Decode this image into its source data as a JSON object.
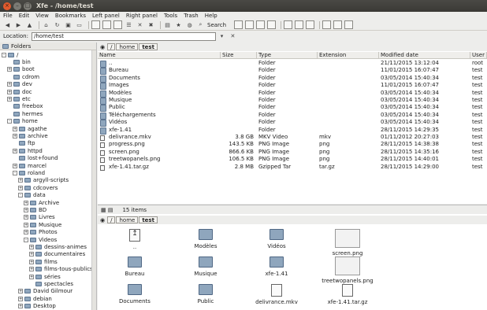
{
  "window": {
    "title": "Xfe - /home/test"
  },
  "menu": [
    "File",
    "Edit",
    "View",
    "Bookmarks",
    "Left panel",
    "Right panel",
    "Tools",
    "Trash",
    "Help"
  ],
  "toolbar": {
    "search_label": "Search"
  },
  "location": {
    "label": "Location:",
    "value": "/home/test"
  },
  "sidebar": {
    "header": "Folders",
    "tree": [
      {
        "label": "/",
        "depth": 0,
        "exp": "-"
      },
      {
        "label": "bin",
        "depth": 1,
        "exp": ""
      },
      {
        "label": "boot",
        "depth": 1,
        "exp": "+"
      },
      {
        "label": "cdrom",
        "depth": 1,
        "exp": ""
      },
      {
        "label": "dev",
        "depth": 1,
        "exp": "+"
      },
      {
        "label": "doc",
        "depth": 1,
        "exp": "+"
      },
      {
        "label": "etc",
        "depth": 1,
        "exp": "+"
      },
      {
        "label": "freebox",
        "depth": 1,
        "exp": ""
      },
      {
        "label": "hermes",
        "depth": 1,
        "exp": ""
      },
      {
        "label": "home",
        "depth": 1,
        "exp": "-"
      },
      {
        "label": "agathe",
        "depth": 2,
        "exp": "+"
      },
      {
        "label": "archive",
        "depth": 2,
        "exp": "+"
      },
      {
        "label": "ftp",
        "depth": 2,
        "exp": ""
      },
      {
        "label": "httpd",
        "depth": 2,
        "exp": "+"
      },
      {
        "label": "lost+found",
        "depth": 2,
        "exp": ""
      },
      {
        "label": "marcel",
        "depth": 2,
        "exp": "+"
      },
      {
        "label": "roland",
        "depth": 2,
        "exp": "-"
      },
      {
        "label": "argyll-scripts",
        "depth": 3,
        "exp": "+"
      },
      {
        "label": "cdcovers",
        "depth": 3,
        "exp": "+"
      },
      {
        "label": "data",
        "depth": 3,
        "exp": "-"
      },
      {
        "label": "Archive",
        "depth": 4,
        "exp": "+"
      },
      {
        "label": "BD",
        "depth": 4,
        "exp": "+"
      },
      {
        "label": "Livres",
        "depth": 4,
        "exp": "+"
      },
      {
        "label": "Musique",
        "depth": 4,
        "exp": "+"
      },
      {
        "label": "Photos",
        "depth": 4,
        "exp": "+"
      },
      {
        "label": "Videos",
        "depth": 4,
        "exp": "-"
      },
      {
        "label": "dessins-animes",
        "depth": 5,
        "exp": "+"
      },
      {
        "label": "documentaires",
        "depth": 5,
        "exp": "+"
      },
      {
        "label": "films",
        "depth": 5,
        "exp": "+"
      },
      {
        "label": "films-tous-publics",
        "depth": 5,
        "exp": "+"
      },
      {
        "label": "séries",
        "depth": 5,
        "exp": "+"
      },
      {
        "label": "spectacles",
        "depth": 5,
        "exp": ""
      },
      {
        "label": "David Gilmour",
        "depth": 3,
        "exp": "+"
      },
      {
        "label": "debian",
        "depth": 3,
        "exp": "+"
      },
      {
        "label": "Desktop",
        "depth": 3,
        "exp": "+"
      }
    ]
  },
  "upper": {
    "crumbs": [
      "/",
      "home",
      "test"
    ],
    "columns": [
      "Name",
      "Size",
      "Type",
      "Extension",
      "Modified date",
      "User"
    ],
    "rows": [
      {
        "name": "..",
        "size": "",
        "type": "Folder",
        "ext": "",
        "date": "21/11/2015 13:12:04",
        "user": "root"
      },
      {
        "name": "Bureau",
        "size": "",
        "type": "Folder",
        "ext": "",
        "date": "11/01/2015 16:07:47",
        "user": "test"
      },
      {
        "name": "Documents",
        "size": "",
        "type": "Folder",
        "ext": "",
        "date": "03/05/2014 15:40:34",
        "user": "test"
      },
      {
        "name": "Images",
        "size": "",
        "type": "Folder",
        "ext": "",
        "date": "11/01/2015 16:07:47",
        "user": "test"
      },
      {
        "name": "Modèles",
        "size": "",
        "type": "Folder",
        "ext": "",
        "date": "03/05/2014 15:40:34",
        "user": "test"
      },
      {
        "name": "Musique",
        "size": "",
        "type": "Folder",
        "ext": "",
        "date": "03/05/2014 15:40:34",
        "user": "test"
      },
      {
        "name": "Public",
        "size": "",
        "type": "Folder",
        "ext": "",
        "date": "03/05/2014 15:40:34",
        "user": "test"
      },
      {
        "name": "Téléchargements",
        "size": "",
        "type": "Folder",
        "ext": "",
        "date": "03/05/2014 15:40:34",
        "user": "test"
      },
      {
        "name": "Vidéos",
        "size": "",
        "type": "Folder",
        "ext": "",
        "date": "03/05/2014 15:40:34",
        "user": "test"
      },
      {
        "name": "xfe-1.41",
        "size": "",
        "type": "Folder",
        "ext": "",
        "date": "28/11/2015 14:29:35",
        "user": "test"
      },
      {
        "name": "delivrance.mkv",
        "size": "3.8 GB",
        "type": "MKV Video",
        "ext": "mkv",
        "date": "01/11/2012 20:27:03",
        "user": "test"
      },
      {
        "name": "progress.png",
        "size": "143.5 KB",
        "type": "PNG Image",
        "ext": "png",
        "date": "28/11/2015 14:38:38",
        "user": "test"
      },
      {
        "name": "screen.png",
        "size": "866.6 KB",
        "type": "PNG Image",
        "ext": "png",
        "date": "28/11/2015 14:35:16",
        "user": "test"
      },
      {
        "name": "treetwopanels.png",
        "size": "106.5 KB",
        "type": "PNG Image",
        "ext": "png",
        "date": "28/11/2015 14:40:01",
        "user": "test"
      },
      {
        "name": "xfe-1.41.tar.gz",
        "size": "2.8 MB",
        "type": "Gzipped Tar",
        "ext": "tar.gz",
        "date": "28/11/2015 14:29:00",
        "user": "test"
      }
    ],
    "status": "15 items"
  },
  "lower": {
    "crumbs": [
      "/",
      "home",
      "test"
    ],
    "icons": [
      {
        "label": "..",
        "kind": "up"
      },
      {
        "label": "Modèles",
        "kind": "folder"
      },
      {
        "label": "Vidéos",
        "kind": "folder"
      },
      {
        "label": "screen.png",
        "kind": "thumb"
      },
      {
        "label": "Bureau",
        "kind": "folder"
      },
      {
        "label": "Musique",
        "kind": "folder"
      },
      {
        "label": "xfe-1.41",
        "kind": "folder"
      },
      {
        "label": "treetwopanels.png",
        "kind": "thumb"
      },
      {
        "label": "Documents",
        "kind": "folder"
      },
      {
        "label": "Public",
        "kind": "folder"
      },
      {
        "label": "delivrance.mkv",
        "kind": "file"
      },
      {
        "label": "xfe-1.41.tar.gz",
        "kind": "file"
      }
    ]
  }
}
